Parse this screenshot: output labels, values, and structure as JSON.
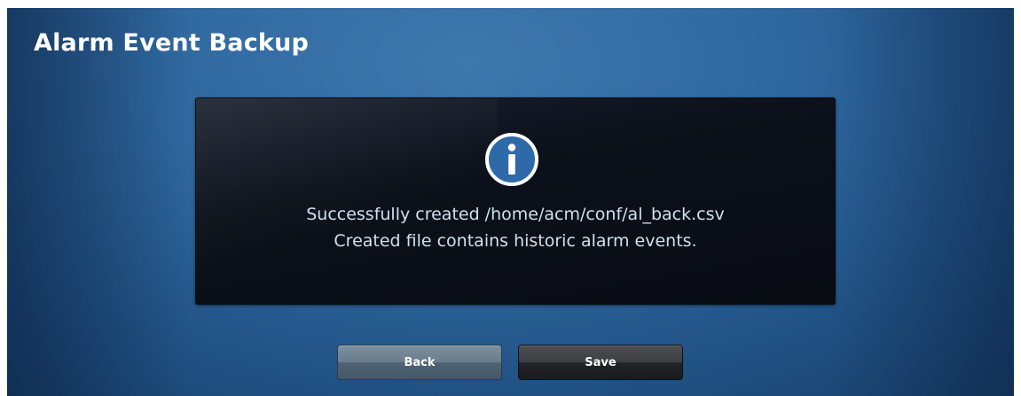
{
  "screen": {
    "title": "Alarm Event Backup"
  },
  "dialog": {
    "icon": "info-icon",
    "line1": "Successfully created /home/acm/conf/al_back.csv",
    "line2": "Created file contains historic alarm events."
  },
  "buttons": {
    "back_label": "Back",
    "save_label": "Save"
  },
  "colors": {
    "background_blue": "#2f689f",
    "message_box": "#0c111b",
    "message_text": "#cfe0ee",
    "icon_fill": "#2f6aa8"
  }
}
